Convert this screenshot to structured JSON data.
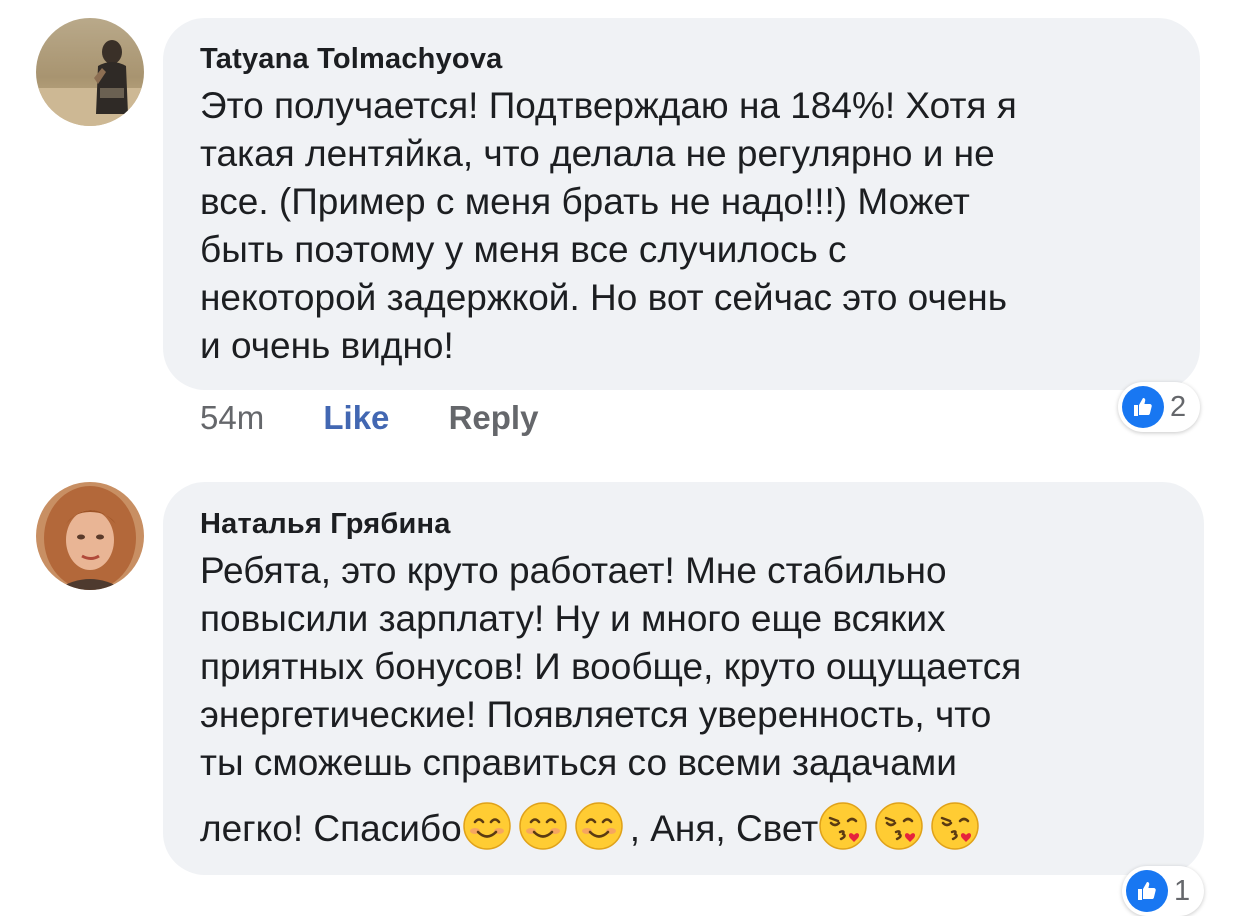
{
  "comments": [
    {
      "author": "Tatyana Tolmachyova",
      "text_lines": [
        "Это получается! Подтверждаю на 184%! Хотя я",
        "такая лентяйка, что делала не регулярно и не",
        "все. (Пример с меня брать не надо!!!) Может",
        "быть поэтому у меня все случилось с",
        "некоторой задержкой. Но вот сейчас это очень",
        "и очень видно!"
      ],
      "time": "54m",
      "like_label": "Like",
      "reply_label": "Reply",
      "reaction_count": "2"
    },
    {
      "author": "Наталья Грябина",
      "text_lines": [
        "Ребята, это круто работает! Мне стабильно",
        "повысили зарплату! Ну и много еще всяких",
        "приятных бонусов! И вообще, круто ощущается",
        "энергетические! Появляется уверенность, что",
        "ты сможешь справиться со всеми задачами"
      ],
      "last_line_start": "легко! Спасибо",
      "last_line_middle": ", Аня, Свет",
      "emojis": [
        "smiling-face-icon",
        "smiling-face-icon",
        "smiling-face-icon",
        "kissing-face-icon",
        "kissing-face-icon",
        "kissing-face-icon"
      ],
      "reaction_count": "1"
    }
  ],
  "colors": {
    "bubble": "#f0f2f5",
    "like_blue": "#4267b2",
    "reaction_blue": "#1877f2",
    "meta_gray": "#65676b"
  }
}
